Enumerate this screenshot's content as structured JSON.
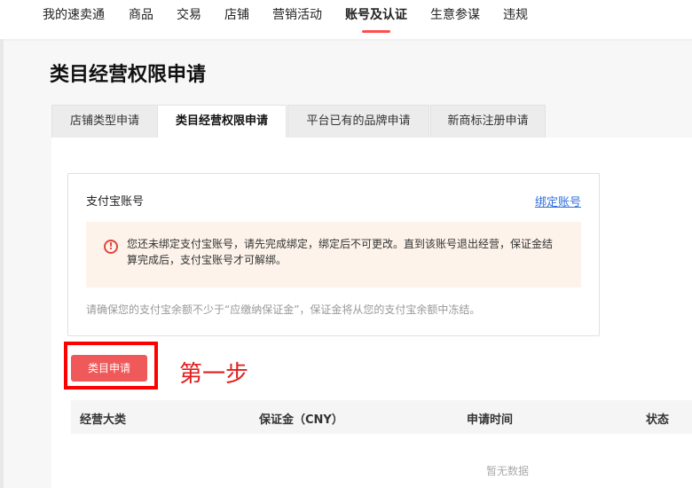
{
  "nav": {
    "items": [
      "我的速卖通",
      "商品",
      "交易",
      "店铺",
      "营销活动",
      "账号及认证",
      "生意参谋",
      "违规"
    ],
    "active_index": 5
  },
  "page": {
    "title": "类目经营权限申请"
  },
  "tabs": [
    {
      "label": "店铺类型申请",
      "active": false
    },
    {
      "label": "类目经营权限申请",
      "active": true
    },
    {
      "label": "平台已有的品牌申请",
      "active": false
    },
    {
      "label": "新商标注册申请",
      "active": false
    }
  ],
  "alipay": {
    "title": "支付宝账号",
    "bind_link": "绑定账号",
    "warning": "您还未绑定支付宝账号，请先完成绑定，绑定后不可更改。直到该账号退出经营，保证金结算完成后，支付宝账号才可解绑。",
    "hint": "请确保您的支付宝余额不少于“应缴纳保证金”，保证金将从您的支付宝余额中冻结。"
  },
  "actions": {
    "apply_label": "类目申请",
    "annotation": "第一步"
  },
  "table": {
    "columns": [
      "经营大类",
      "保证金（CNY）",
      "申请时间",
      "状态"
    ],
    "empty_text": "暂无数据"
  },
  "colors": {
    "accent": "#ff4d4f",
    "button": "#f0595a",
    "annotation": "#e21d1d",
    "link": "#2f6fd8",
    "warning_bg": "#fdf3ea"
  }
}
